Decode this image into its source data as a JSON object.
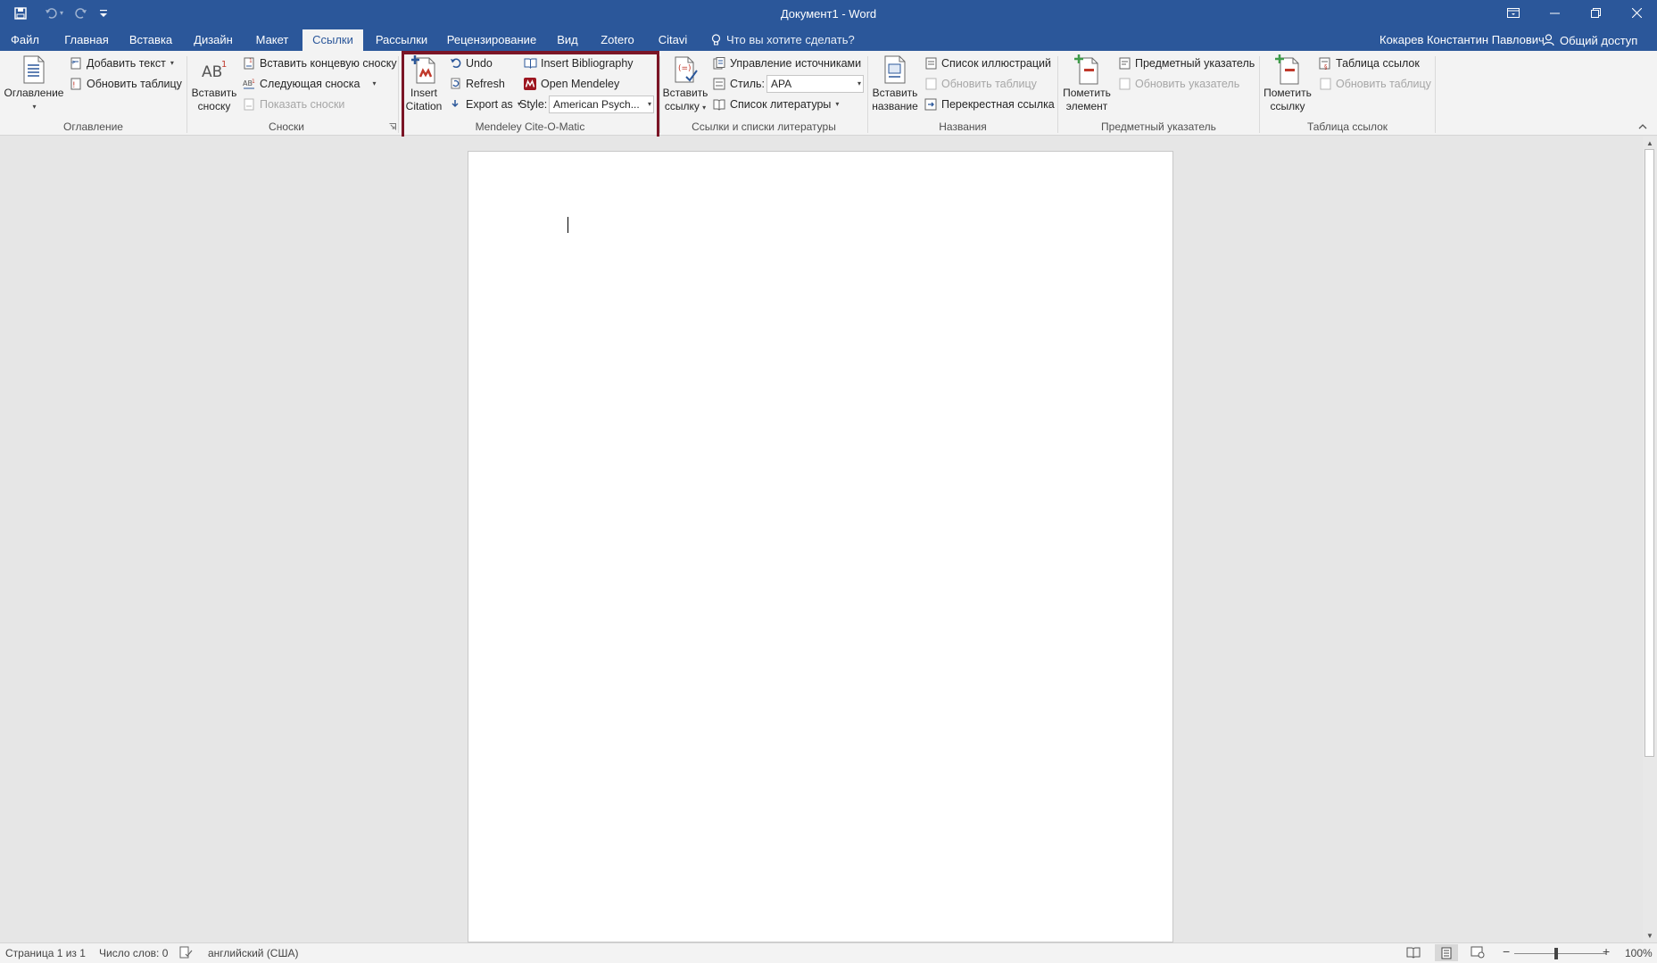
{
  "window": {
    "title": "Документ1 - Word",
    "user_name": "Кокарев Константин Павлович",
    "share_label": "Общий доступ"
  },
  "quick_access": [
    {
      "icon": "save-icon",
      "enabled": true
    },
    {
      "icon": "undo-icon",
      "enabled": false
    },
    {
      "icon": "redo-icon",
      "enabled": false
    },
    {
      "icon": "customize-qat-icon",
      "enabled": true
    }
  ],
  "tabs": [
    "Файл",
    "Главная",
    "Вставка",
    "Дизайн",
    "Макет",
    "Ссылки",
    "Рассылки",
    "Рецензирование",
    "Вид",
    "Zotero",
    "Citavi"
  ],
  "active_tab": "Ссылки",
  "tell_me": {
    "text": "Что вы хотите сделать?",
    "icon": "lightbulb-icon"
  },
  "ribbon": {
    "toc": {
      "label": "Оглавление",
      "big_button": "Оглавление",
      "add_text": "Добавить текст",
      "update_table": "Обновить таблицу"
    },
    "footnotes": {
      "label": "Сноски",
      "big_button": [
        "Вставить",
        "сноску"
      ],
      "insert_endnote": "Вставить концевую сноску",
      "next_footnote": "Следующая сноска",
      "show_notes": "Показать сноски"
    },
    "mendeley": {
      "label": "Mendeley Cite-O-Matic",
      "big_button": [
        "Insert",
        "Citation"
      ],
      "undo": "Undo",
      "refresh": "Refresh",
      "export_as": "Export as",
      "insert_bibliography": "Insert Bibliography",
      "open_mendeley": "Open Mendeley",
      "style_label": "Style:",
      "style_value": "American Psych...",
      "highlight_color": "#7b1526"
    },
    "citations": {
      "label": "Ссылки и списки литературы",
      "big_button": [
        "Вставить",
        "ссылку"
      ],
      "manage_sources": "Управление источниками",
      "style_label": "Стиль:",
      "style_value": "APA",
      "bibliography": "Список литературы"
    },
    "captions": {
      "label": "Названия",
      "big_button": [
        "Вставить",
        "название"
      ],
      "table_of_figures": "Список иллюстраций",
      "update_table": "Обновить таблицу",
      "cross_reference": "Перекрестная ссылка"
    },
    "index": {
      "label": "Предметный указатель",
      "big_button": [
        "Пометить",
        "элемент"
      ],
      "insert_index": "Предметный указатель",
      "update_index": "Обновить указатель"
    },
    "authorities": {
      "label": "Таблица ссылок",
      "big_button": [
        "Пометить",
        "ссылку"
      ],
      "insert_table": "Таблица ссылок",
      "update_table": "Обновить таблицу"
    }
  },
  "status_bar": {
    "page": "Страница 1 из 1",
    "words": "Число слов: 0",
    "language": "английский (США)",
    "zoom": "100%"
  },
  "colors": {
    "brand": "#2b579a",
    "ribbon_bg": "#f3f3f3",
    "canvas_bg": "#e6e6e6"
  }
}
